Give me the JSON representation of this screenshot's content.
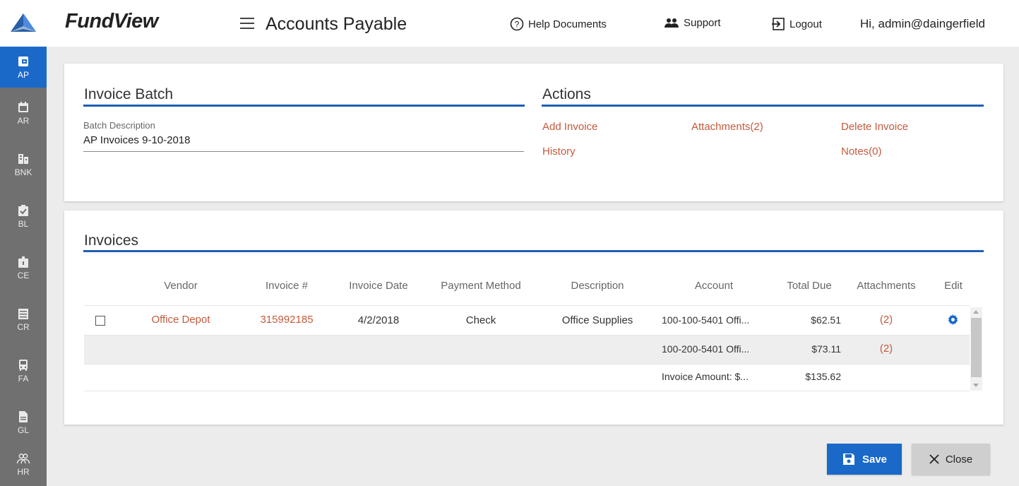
{
  "app": {
    "name": "FundView",
    "page_title": "Accounts Payable"
  },
  "topnav": {
    "help_label": "Help Documents",
    "support_label": "Support",
    "logout_label": "Logout",
    "greeting": "Hi, admin@daingerfield"
  },
  "sidebar": {
    "items": [
      {
        "label": "AP",
        "icon": "wallet-icon",
        "active": true
      },
      {
        "label": "AR",
        "icon": "calendar-icon"
      },
      {
        "label": "BNK",
        "icon": "bank-icon"
      },
      {
        "label": "BL",
        "icon": "clipboard-check-icon"
      },
      {
        "label": "CE",
        "icon": "briefcase-icon"
      },
      {
        "label": "CR",
        "icon": "receipt-icon"
      },
      {
        "label": "FA",
        "icon": "bus-icon"
      },
      {
        "label": "GL",
        "icon": "file-icon"
      },
      {
        "label": "HR",
        "icon": "people-icon"
      }
    ]
  },
  "batch": {
    "title": "Invoice Batch",
    "description_label": "Batch Description",
    "description_value": "AP Invoices 9-10-2018"
  },
  "actions": {
    "title": "Actions",
    "add_invoice": "Add Invoice",
    "attachments": "Attachments(2)",
    "delete_invoice": "Delete Invoice",
    "history": "History",
    "notes": "Notes(0)"
  },
  "invoices": {
    "title": "Invoices",
    "columns": [
      "Vendor",
      "Invoice #",
      "Invoice Date",
      "Payment Method",
      "Description",
      "Account",
      "Total Due",
      "Attachments",
      "Edit"
    ],
    "row": {
      "vendor": "Office Depot",
      "invoice_no": "315992185",
      "invoice_date": "4/2/2018",
      "payment_method": "Check",
      "description": "Office Supplies",
      "lines": [
        {
          "account": "100-100-5401 Offi...",
          "total": "$62.51",
          "attachments": "(2)"
        },
        {
          "account": "100-200-5401 Offi...",
          "total": "$73.11",
          "attachments": "(2)"
        }
      ],
      "summary_label": "Invoice Amount: $...",
      "summary_total": "$135.62"
    }
  },
  "buttons": {
    "save": "Save",
    "close": "Close"
  },
  "colors": {
    "primary": "#1a69c9",
    "link": "#c45a3c",
    "sidebar": "#707070",
    "rule": "#1e5fb4"
  }
}
